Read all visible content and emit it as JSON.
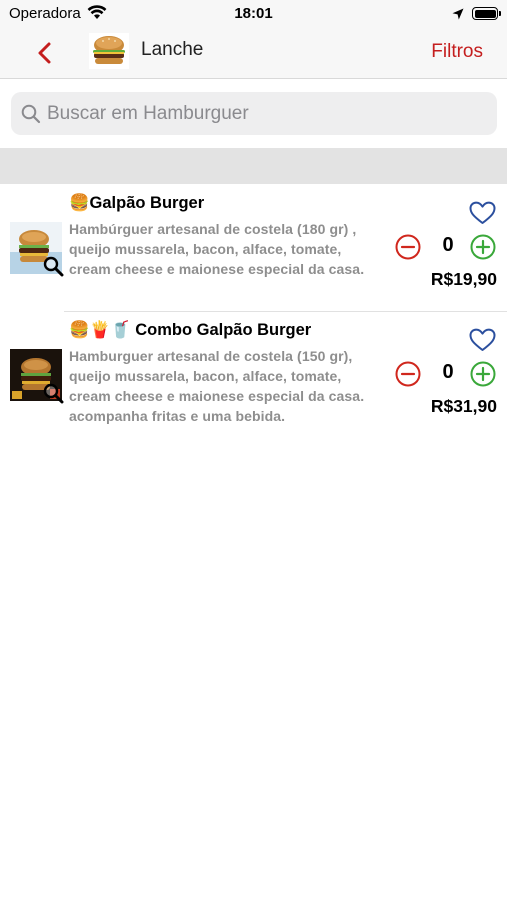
{
  "status_bar": {
    "carrier": "Operadora",
    "time": "18:01"
  },
  "nav": {
    "title": "Lanche",
    "filters_label": "Filtros",
    "back_icon": "chevron-left-icon",
    "accent_color": "#c41e1e"
  },
  "search": {
    "placeholder": "Buscar em Hamburguer",
    "value": ""
  },
  "products": [
    {
      "name": "🍔Galpão Burger",
      "description": "Hambúrguer artesanal de costela (180 gr) , queijo mussarela, bacon, alface, tomate, cream cheese e maionese especial da casa.",
      "quantity": "0",
      "price": "R$19,90",
      "favorite": false
    },
    {
      "name": "🍔🍟🥤 Combo Galpão Burger",
      "description": "Hamburguer artesanal de costela (150 gr), queijo mussarela, bacon, alface, tomate, cream cheese e maionese especial da casa. acompanha fritas e uma bebida.",
      "quantity": "0",
      "price": "R$31,90",
      "favorite": false
    }
  ],
  "colors": {
    "minus": "#d0271d",
    "plus": "#3aa83a",
    "heart": "#2b4f9e"
  }
}
